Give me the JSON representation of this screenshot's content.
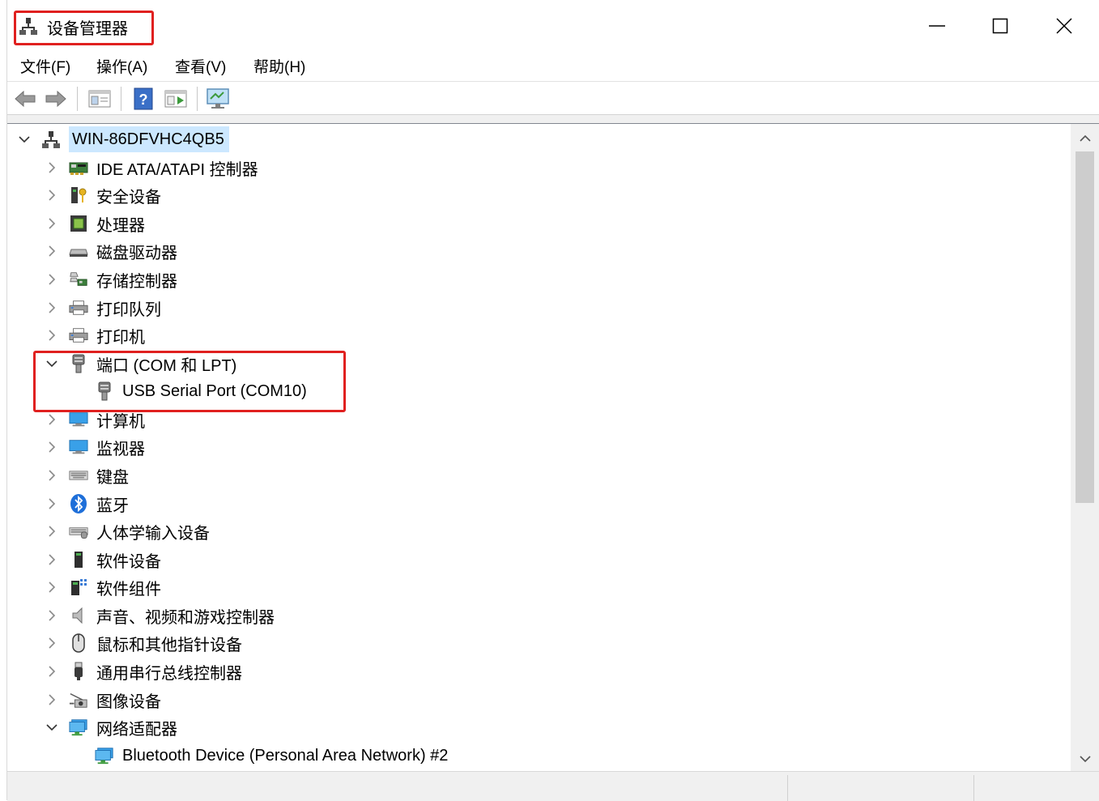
{
  "window": {
    "title": "设备管理器",
    "minimize_label": "—",
    "maximize_label": "☐",
    "close_label": "✕"
  },
  "menu": [
    {
      "label": "文件(F)"
    },
    {
      "label": "操作(A)"
    },
    {
      "label": "查看(V)"
    },
    {
      "label": "帮助(H)"
    }
  ],
  "toolbar": [
    {
      "icon": "back-arrow-icon"
    },
    {
      "icon": "forward-arrow-icon"
    },
    {
      "icon": "properties-icon"
    },
    {
      "icon": "help-icon"
    },
    {
      "icon": "run-icon"
    },
    {
      "icon": "monitor-scan-icon"
    }
  ],
  "tree": {
    "root": {
      "label": "WIN-86DFVHC4QB5",
      "expanded": true,
      "selected": true
    },
    "items": [
      {
        "label": "IDE ATA/ATAPI 控制器",
        "icon": "ide-controller-icon",
        "expanded": false
      },
      {
        "label": "安全设备",
        "icon": "security-device-icon",
        "expanded": false
      },
      {
        "label": "处理器",
        "icon": "processor-icon",
        "expanded": false
      },
      {
        "label": "磁盘驱动器",
        "icon": "disk-drive-icon",
        "expanded": false
      },
      {
        "label": "存储控制器",
        "icon": "storage-controller-icon",
        "expanded": false
      },
      {
        "label": "打印队列",
        "icon": "print-queue-icon",
        "expanded": false
      },
      {
        "label": "打印机",
        "icon": "printer-icon",
        "expanded": false
      },
      {
        "label": "端口 (COM 和 LPT)",
        "icon": "port-icon",
        "expanded": true,
        "children": [
          {
            "label": "USB Serial Port (COM10)",
            "icon": "port-icon"
          }
        ]
      },
      {
        "label": "计算机",
        "icon": "computer-icon",
        "expanded": false
      },
      {
        "label": "监视器",
        "icon": "monitor-icon",
        "expanded": false
      },
      {
        "label": "键盘",
        "icon": "keyboard-icon",
        "expanded": false
      },
      {
        "label": "蓝牙",
        "icon": "bluetooth-icon",
        "expanded": false
      },
      {
        "label": "人体学输入设备",
        "icon": "hid-icon",
        "expanded": false
      },
      {
        "label": "软件设备",
        "icon": "software-device-icon",
        "expanded": false
      },
      {
        "label": "软件组件",
        "icon": "software-component-icon",
        "expanded": false
      },
      {
        "label": "声音、视频和游戏控制器",
        "icon": "speaker-icon",
        "expanded": false
      },
      {
        "label": "鼠标和其他指针设备",
        "icon": "mouse-icon",
        "expanded": false
      },
      {
        "label": "通用串行总线控制器",
        "icon": "usb-icon",
        "expanded": false
      },
      {
        "label": "图像设备",
        "icon": "imaging-device-icon",
        "expanded": false
      },
      {
        "label": "网络适配器",
        "icon": "network-adapter-icon",
        "expanded": true,
        "children": [
          {
            "label": "Bluetooth Device (Personal Area Network) #2",
            "icon": "network-adapter-icon"
          }
        ]
      }
    ]
  },
  "colors": {
    "highlight": "#e0201f",
    "selection": "#cce8ff"
  }
}
